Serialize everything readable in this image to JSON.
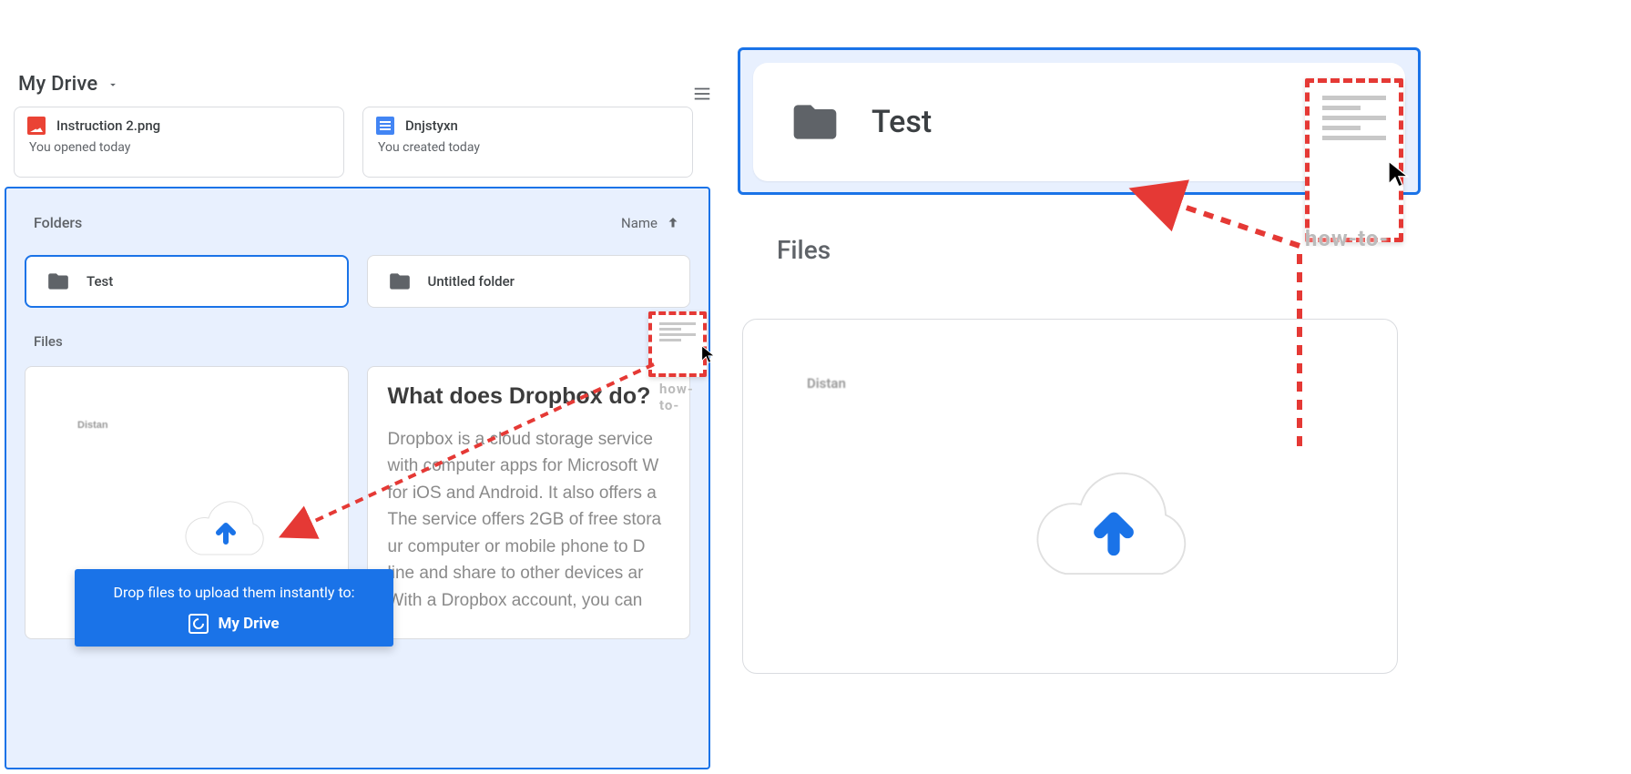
{
  "breadcrumb": {
    "label": "My Drive"
  },
  "recent": [
    {
      "title": "Instruction 2.png",
      "sub": "You opened today",
      "icon": "image"
    },
    {
      "title": "Dnjstyxn",
      "sub": "You created today",
      "icon": "doc"
    }
  ],
  "section_labels": {
    "folders": "Folders",
    "files": "Files"
  },
  "sort": {
    "label": "Name"
  },
  "folders": [
    {
      "name": "Test",
      "selected": true
    },
    {
      "name": "Untitled folder",
      "selected": false
    }
  ],
  "doc_preview": {
    "placeholder_blur_text": "Distan",
    "heading": "What does Dropbox do?",
    "body": "Dropbox is a cloud storage service with computer apps for Microsoft W for iOS and Android. It also offers a The service offers 2GB of free stora ur computer or mobile phone to D line and share to other devices ar With a Dropbox account, you can"
  },
  "drop_tooltip": {
    "line1": "Drop files to upload them instantly to:",
    "line2": "My Drive"
  },
  "drag_ghost": {
    "caption": "how-to-"
  },
  "right": {
    "folder_name": "Test",
    "files_label": "Files",
    "placeholder_blur_text": "Distan",
    "drag_caption": "how-to-"
  }
}
